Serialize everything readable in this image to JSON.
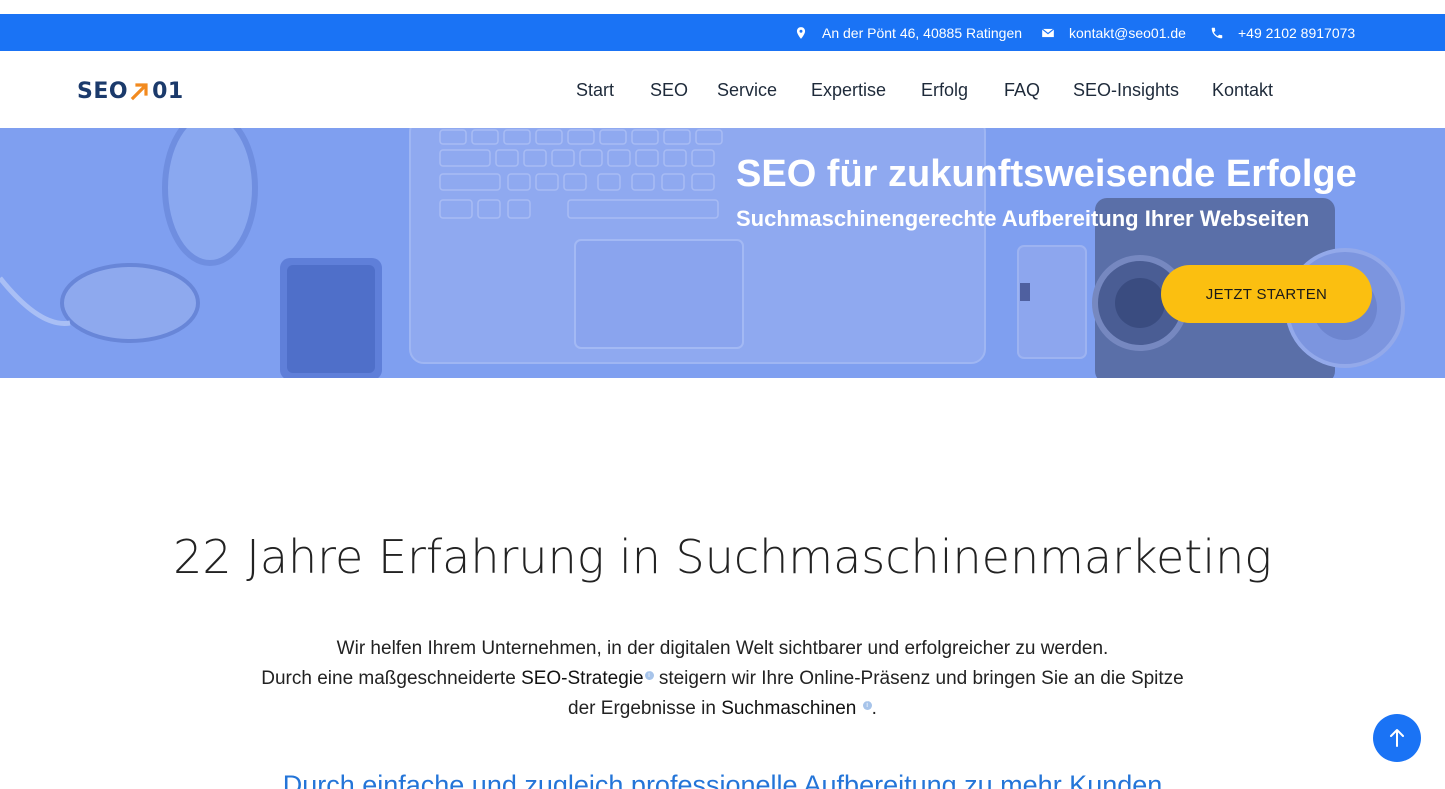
{
  "topbar": {
    "address": "An der Pönt 46, 40885 Ratingen",
    "email": "kontakt@seo01.de",
    "phone": "+49 2102 8917073"
  },
  "logo": {
    "text_left": "SEO",
    "text_right": "01"
  },
  "nav": {
    "items": [
      {
        "label": "Start"
      },
      {
        "label": "SEO"
      },
      {
        "label": "Service"
      },
      {
        "label": "Expertise"
      },
      {
        "label": "Erfolg"
      },
      {
        "label": "FAQ"
      },
      {
        "label": "SEO-Insights"
      },
      {
        "label": "Kontakt"
      }
    ]
  },
  "hero": {
    "title": "SEO für zukunftsweisende Erfolge",
    "subtitle": "Suchmaschinengerechte Aufbereitung Ihrer Webseiten",
    "cta_label": "JETZT STARTEN"
  },
  "intro": {
    "title": "22 Jahre Erfahrung in Suchmaschinenmarketing",
    "line1": "Wir helfen Ihrem Unternehmen, in der digitalen Welt sichtbarer und erfolgreicher zu werden.",
    "line2_pre": "Durch eine maßgeschneiderte ",
    "line2_link": "SEO-Strategie",
    "line2_post": " steigern wir Ihre Online-Präsenz und bringen Sie an die Spitze",
    "line3_pre": "der Ergebnisse in ",
    "line3_link": "Suchmaschinen",
    "line3_post": ".",
    "info_glyph": "i"
  },
  "subheading": "Durch einfache und zugleich professionelle Aufbereitung zu mehr Kunden",
  "colors": {
    "brand_blue": "#1a73f5",
    "hero_overlay": "#7f9ff0",
    "cta_yellow": "#fbbf10",
    "logo_navy": "#1b3a6b",
    "logo_orange": "#f28a1f",
    "subheading_blue": "#2475d8"
  },
  "icons": {
    "address": "map-pin-icon",
    "email": "envelope-icon",
    "phone": "phone-icon",
    "scroll_top": "arrow-up-icon",
    "logo_arrow": "arrow-up-right-icon"
  }
}
